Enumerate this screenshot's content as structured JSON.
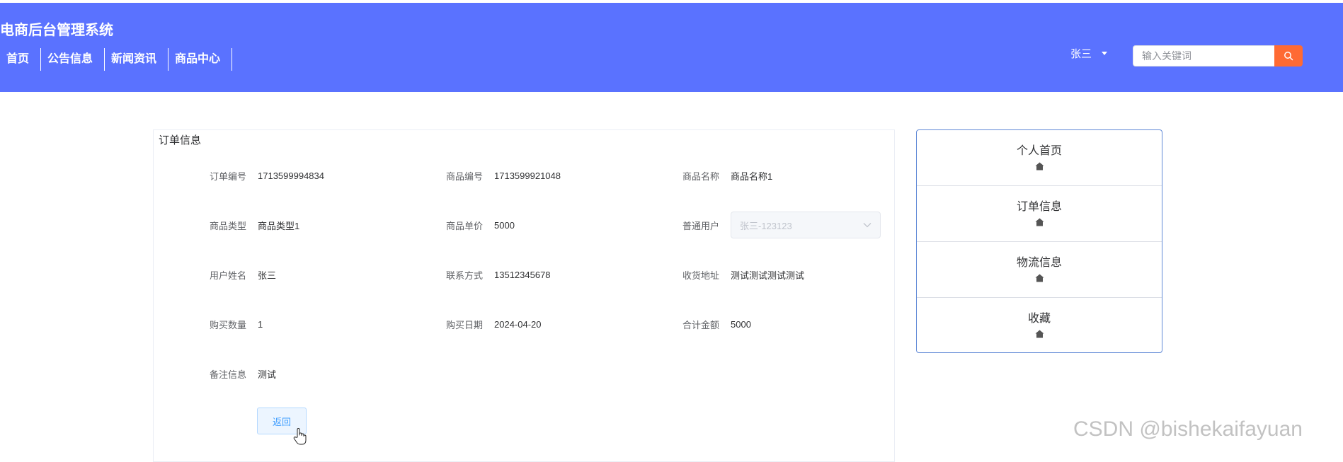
{
  "site_title": "电商后台管理系统",
  "nav": [
    {
      "label": "首页"
    },
    {
      "label": "公告信息"
    },
    {
      "label": "新闻资讯"
    },
    {
      "label": "商品中心"
    }
  ],
  "user": {
    "name": "张三"
  },
  "search": {
    "placeholder": "输入关键词"
  },
  "order": {
    "title": "订单信息",
    "fields": {
      "order_no": {
        "label": "订单编号",
        "value": "1713599994834"
      },
      "product_no": {
        "label": "商品编号",
        "value": "1713599921048"
      },
      "product_name": {
        "label": "商品名称",
        "value": "商品名称1"
      },
      "product_type": {
        "label": "商品类型",
        "value": "商品类型1"
      },
      "unit_price": {
        "label": "商品单价",
        "value": "5000"
      },
      "regular_user": {
        "label": "普通用户",
        "value": "张三-123123"
      },
      "user_name": {
        "label": "用户姓名",
        "value": "张三"
      },
      "contact": {
        "label": "联系方式",
        "value": "13512345678"
      },
      "address": {
        "label": "收货地址",
        "value": "测试测试测试测试"
      },
      "quantity": {
        "label": "购买数量",
        "value": "1"
      },
      "purchase_date": {
        "label": "购买日期",
        "value": "2024-04-20"
      },
      "total": {
        "label": "合计金额",
        "value": "5000"
      },
      "remark": {
        "label": "备注信息",
        "value": "测试"
      }
    },
    "back_label": "返回"
  },
  "side_menu": [
    {
      "label": "个人首页",
      "icon": "home-icon"
    },
    {
      "label": "订单信息",
      "icon": "home-icon"
    },
    {
      "label": "物流信息",
      "icon": "home-icon"
    },
    {
      "label": "收藏",
      "icon": "home-icon"
    }
  ],
  "watermark": "CSDN @bishekaifayuan",
  "colors": {
    "header_bg": "#5a72ff",
    "search_button": "#ff6a33",
    "primary": "#409eff",
    "side_border": "#5f88d6"
  }
}
